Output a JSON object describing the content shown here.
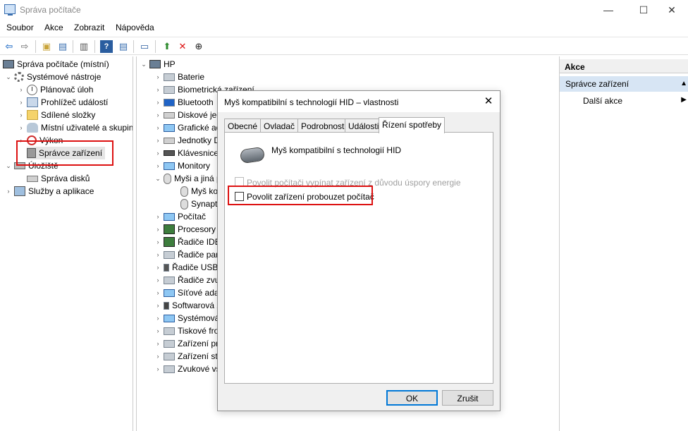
{
  "window": {
    "title": "Správa počítače",
    "minimize": "—",
    "maximize": "☐",
    "close": "✕"
  },
  "menu": [
    "Soubor",
    "Akce",
    "Zobrazit",
    "Nápověda"
  ],
  "toolbar_icons": [
    "back-icon",
    "forward-icon",
    "up-folder-icon",
    "show-hide-tree-icon",
    "properties-icon",
    "help-icon",
    "action-pane-icon",
    "monitor-icon",
    "update-driver-icon",
    "uninstall-icon",
    "download-icon"
  ],
  "left_tree": [
    {
      "label": "Správa počítače (místní)",
      "icon": "pc"
    },
    {
      "label": "Systémové nástroje",
      "icon": "gear"
    },
    {
      "label": "Plánovač úloh",
      "icon": "clock"
    },
    {
      "label": "Prohlížeč událostí",
      "icon": "log"
    },
    {
      "label": "Sdílené složky",
      "icon": "folder"
    },
    {
      "label": "Místní uživatelé a skupiny",
      "icon": "users"
    },
    {
      "label": "Výkon",
      "icon": "perf"
    },
    {
      "label": "Správce zařízení",
      "icon": "devmgr"
    },
    {
      "label": "Úložiště",
      "icon": "storage"
    },
    {
      "label": "Správa disků",
      "icon": "disk"
    },
    {
      "label": "Služby a aplikace",
      "icon": "services"
    }
  ],
  "device_tree": [
    {
      "label": "HP"
    },
    {
      "label": "Baterie"
    },
    {
      "label": "Biometrická zařízení"
    },
    {
      "label": "Bluetooth"
    },
    {
      "label": "Diskové jednotky"
    },
    {
      "label": "Grafické adaptéry"
    },
    {
      "label": "Jednotky DVD/CD-ROM"
    },
    {
      "label": "Klávesnice"
    },
    {
      "label": "Monitory"
    },
    {
      "label": "Myši a jiná polohovací zařízení"
    },
    {
      "label": "Myš kompatibilní s technologií HID"
    },
    {
      "label": "Synaptics"
    },
    {
      "label": "Počítač"
    },
    {
      "label": "Procesory"
    },
    {
      "label": "Řadiče IDE ATA/ATAPI"
    },
    {
      "label": "Řadiče paměťových zařízení"
    },
    {
      "label": "Řadiče USB"
    },
    {
      "label": "Řadiče zvuku, videa a her"
    },
    {
      "label": "Síťové adaptéry"
    },
    {
      "label": "Softwarová zařízení"
    },
    {
      "label": "Systémová zařízení"
    },
    {
      "label": "Tiskové fronty"
    },
    {
      "label": "Zařízení pro zpracování obrazu"
    },
    {
      "label": "Zařízení standardu HID"
    },
    {
      "label": "Zvukové vstupy a výstupy"
    }
  ],
  "actions": {
    "header": "Akce",
    "section": "Správce zařízení",
    "more": "Další akce"
  },
  "dialog": {
    "title": "Myš kompatibilní s technologií HID – vlastnosti",
    "close": "✕",
    "tabs": [
      "Obecné",
      "Ovladač",
      "Podrobnosti",
      "Události",
      "Řízení spotřeby"
    ],
    "device_name": "Myš kompatibilní s technologií HID",
    "option_power_off": "Povolit počítači vypínat zařízení z důvodu úspory energie",
    "option_wake": "Povolit zařízení probouzet počítač",
    "ok": "OK",
    "cancel": "Zrušit"
  }
}
